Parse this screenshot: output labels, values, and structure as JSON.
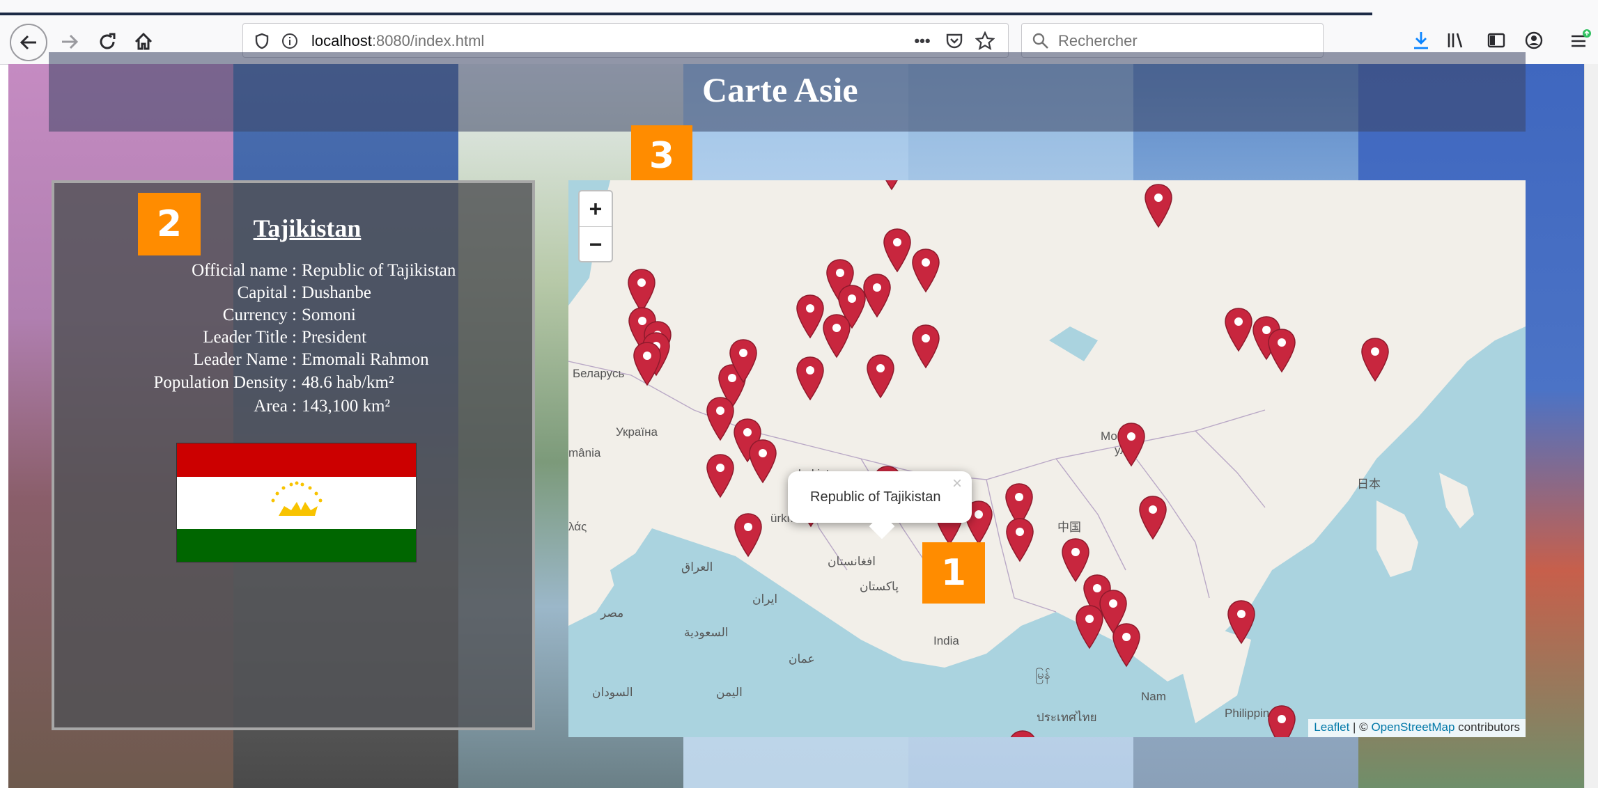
{
  "browser": {
    "url_host": "localhost",
    "url_rest": ":8080/index.html",
    "more_label": "•••",
    "search_placeholder": "Rechercher"
  },
  "page": {
    "title": "Carte Asie",
    "badges": {
      "map": "1",
      "info": "2",
      "title": "3"
    }
  },
  "info": {
    "country": "Tajikistan",
    "rows": [
      {
        "label": "Official name :",
        "value": "Republic of Tajikistan"
      },
      {
        "label": "Capital :",
        "value": "Dushanbe"
      },
      {
        "label": "Currency :",
        "value": "Somoni"
      },
      {
        "label": "Leader Title :",
        "value": "President"
      },
      {
        "label": "Leader Name :",
        "value": "Emomali Rahmon"
      },
      {
        "label": "Population Density :",
        "value": "48.6 hab/km²"
      },
      {
        "label": "Area :",
        "value": "143,100 km²"
      }
    ],
    "flag_colors": [
      "#cc0000",
      "#ffffff",
      "#006600"
    ]
  },
  "map": {
    "zoom_in": "+",
    "zoom_out": "−",
    "popup_text": "Republic of Tajikistan",
    "popup_close": "×",
    "attribution_leaflet": "Leaflet",
    "attribution_sep": " | © ",
    "attribution_osm": "OpenStreetMap",
    "attribution_tail": " contributors",
    "labels": {
      "belarus": "Беларусь",
      "ukraine": "Україна",
      "romania": "mânia",
      "greece": "λάς",
      "uzbekistan": "bekistо",
      "turkmenistan": "ürkmenistan",
      "iraq": "العراق",
      "egypt": "مصر",
      "saudi": "السعودية",
      "afghanistan": "افغانستان",
      "pakistan": "پاکستان",
      "iran": "ایران",
      "oman": "عمان",
      "yemen": "اليمن",
      "sudan": "السودان",
      "india": "India",
      "mongolia1": "Монгол",
      "mongolia2": "улс",
      "china": "中国",
      "japan": "日本",
      "vietnam": "Nam",
      "thailand": "ประเทศไทย",
      "philippines": "Philippines",
      "myanmar": "မြန်"
    },
    "marker_color": "#c8263e"
  }
}
